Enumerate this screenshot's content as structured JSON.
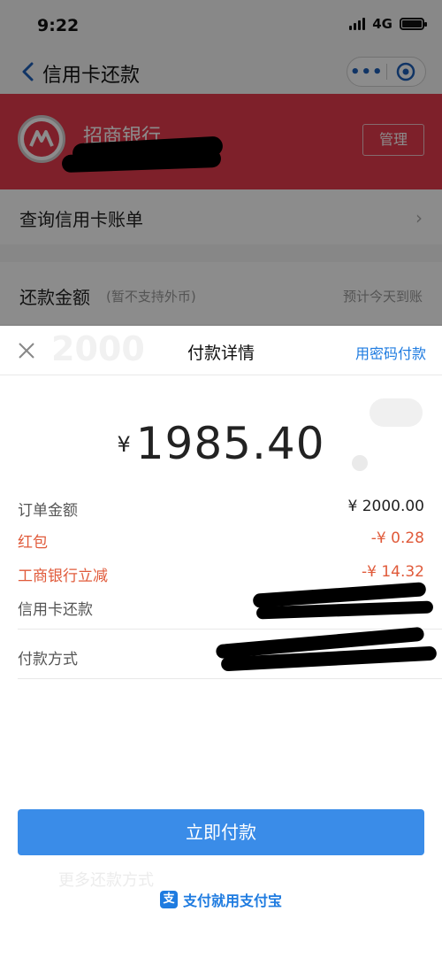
{
  "status_bar": {
    "time": "9:22",
    "network": "4G"
  },
  "nav": {
    "title": "信用卡还款"
  },
  "bank": {
    "name": "招商银行",
    "manage_label": "管理"
  },
  "bill_row": {
    "label": "查询信用卡账单"
  },
  "amount_row": {
    "label": "还款金额",
    "sub": "(暂不支持外币)",
    "right": "预计今天到账",
    "ghost_amount": "2000"
  },
  "ghost_lines": {
    "more_methods": "更多还款方式"
  },
  "sheet": {
    "title": "付款详情",
    "password_link": "用密码付款",
    "currency": "¥",
    "amount": "1985.40",
    "rows": [
      {
        "key": "订单金额",
        "value": "¥ 2000.00"
      },
      {
        "key": "红包",
        "value": "-¥ 0.28"
      },
      {
        "key": "工商银行立减",
        "value": "-¥ 14.32"
      },
      {
        "key": "信用卡还款",
        "value": ""
      }
    ],
    "pay_method_label": "付款方式",
    "pay_button": "立即付款",
    "footer": "支付就用支付宝"
  },
  "colors": {
    "primary_blue": "#3a8ce8",
    "bank_red": "#e53b4e",
    "discount_red": "#e05a3a"
  }
}
